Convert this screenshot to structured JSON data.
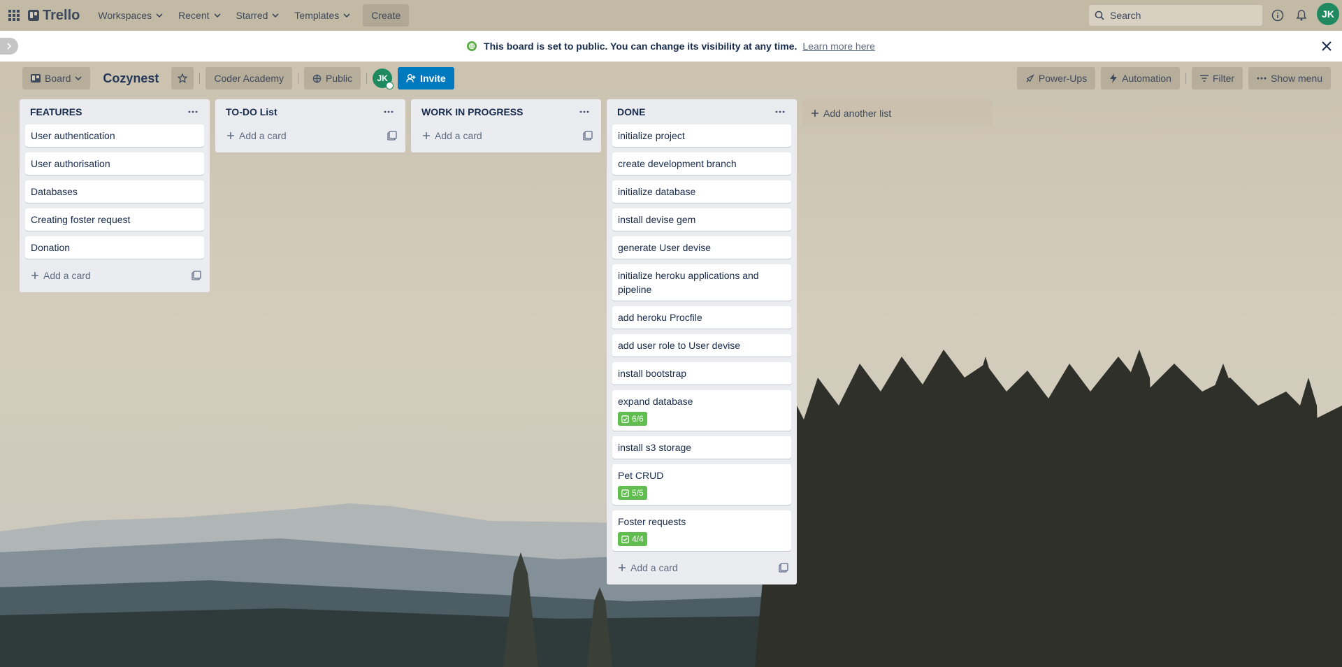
{
  "app": {
    "name": "Trello"
  },
  "topnav": {
    "menus": [
      "Workspaces",
      "Recent",
      "Starred",
      "Templates"
    ],
    "create_label": "Create",
    "search_placeholder": "Search",
    "user_initials": "JK"
  },
  "banner": {
    "message": "This board is set to public. You can change its visibility at any time.",
    "link": "Learn more here"
  },
  "board": {
    "view_label": "Board",
    "title": "Cozynest",
    "workspace": "Coder Academy",
    "visibility": "Public",
    "member_initials": "JK",
    "invite_label": "Invite",
    "powerups_label": "Power-Ups",
    "automation_label": "Automation",
    "filter_label": "Filter",
    "show_menu_label": "Show menu"
  },
  "lists": [
    {
      "title": "FEATURES",
      "cards": [
        {
          "title": "User authentication"
        },
        {
          "title": "User authorisation"
        },
        {
          "title": "Databases"
        },
        {
          "title": "Creating foster request"
        },
        {
          "title": "Donation"
        }
      ],
      "add_label": "Add a card"
    },
    {
      "title": "TO-DO List",
      "cards": [],
      "add_label": "Add a card"
    },
    {
      "title": "WORK IN PROGRESS",
      "cards": [],
      "add_label": "Add a card"
    },
    {
      "title": "DONE",
      "cards": [
        {
          "title": "initialize project"
        },
        {
          "title": "create development branch"
        },
        {
          "title": "initialize database"
        },
        {
          "title": "install devise gem"
        },
        {
          "title": "generate User devise"
        },
        {
          "title": "initialize heroku applications and pipeline"
        },
        {
          "title": "add heroku Procfile"
        },
        {
          "title": "add user role to User devise"
        },
        {
          "title": "install bootstrap"
        },
        {
          "title": "expand database",
          "checklist": "6/6"
        },
        {
          "title": "install s3 storage"
        },
        {
          "title": "Pet CRUD",
          "checklist": "5/5"
        },
        {
          "title": "Foster requests",
          "checklist": "4/4"
        }
      ],
      "add_label": "Add a card"
    }
  ],
  "add_list_label": "Add another list",
  "colors": {
    "invite": "#0079bf",
    "badge_complete": "#61bd4f",
    "avatar": "#1f8a5f",
    "list_bg": "#ebecf0"
  }
}
